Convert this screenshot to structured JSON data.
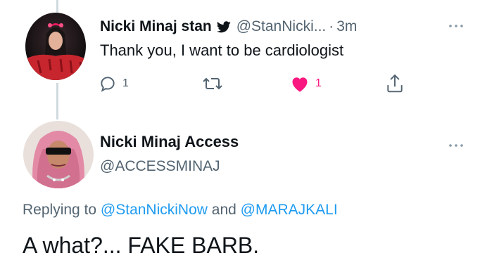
{
  "tweet1": {
    "display_name": "Nicki Minaj stan",
    "handle": "@StanNicki...",
    "separator": "·",
    "time": "3m",
    "text": "Thank you, I want to be cardiologist",
    "actions": {
      "reply_count": "1",
      "retweet_count": "",
      "like_count": "1",
      "liked": true
    },
    "colors": {
      "like": "#f91880",
      "muted": "#536471"
    }
  },
  "tweet2": {
    "display_name": "Nicki Minaj Access",
    "handle": "@ACCESSMINAJ",
    "replying_prefix": "Replying to",
    "mention1": "@StanNickiNow",
    "replying_and": "and",
    "mention2": "@MARAJKALI",
    "text": "A what?... FAKE BARB.",
    "colors": {
      "mention": "#1d9bf0"
    }
  },
  "more_icon": "more-horizontal-icon"
}
